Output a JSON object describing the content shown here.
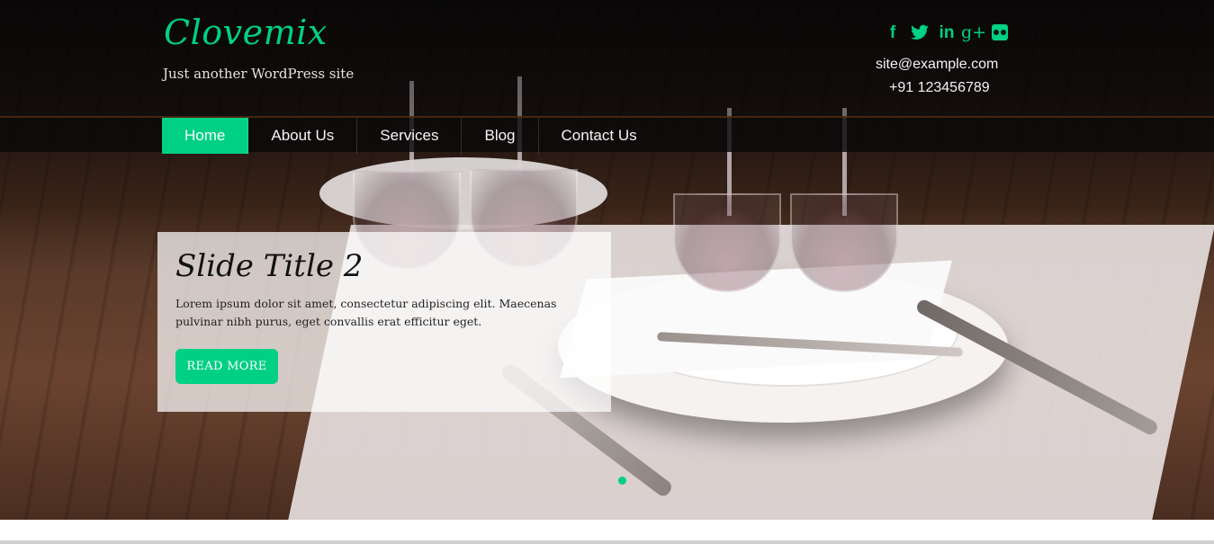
{
  "header": {
    "site_title": "Clovemix",
    "tagline": "Just another WordPress site",
    "social_icons": [
      "facebook-icon",
      "twitter-icon",
      "linkedin-icon",
      "google-plus-icon",
      "flickr-icon"
    ],
    "social_glyphs": {
      "facebook": "f",
      "twitter": "🐦",
      "linkedin": "in",
      "google_plus": "g+"
    },
    "email": "site@example.com",
    "phone": "+91 123456789"
  },
  "nav": {
    "items": [
      {
        "label": "Home",
        "active": true
      },
      {
        "label": "About Us",
        "active": false
      },
      {
        "label": "Services",
        "active": false
      },
      {
        "label": "Blog",
        "active": false
      },
      {
        "label": "Contact Us",
        "active": false
      }
    ]
  },
  "slide": {
    "title": "Slide Title 2",
    "text": "Lorem ipsum dolor sit amet, consectetur adipiscing elit. Maecenas pulvinar nibh purus, eget convallis erat efficitur eget.",
    "button_label": "READ MORE"
  },
  "colors": {
    "accent": "#00d084",
    "nav_bg": "#0a0808",
    "text_light": "#f2f2f2"
  }
}
